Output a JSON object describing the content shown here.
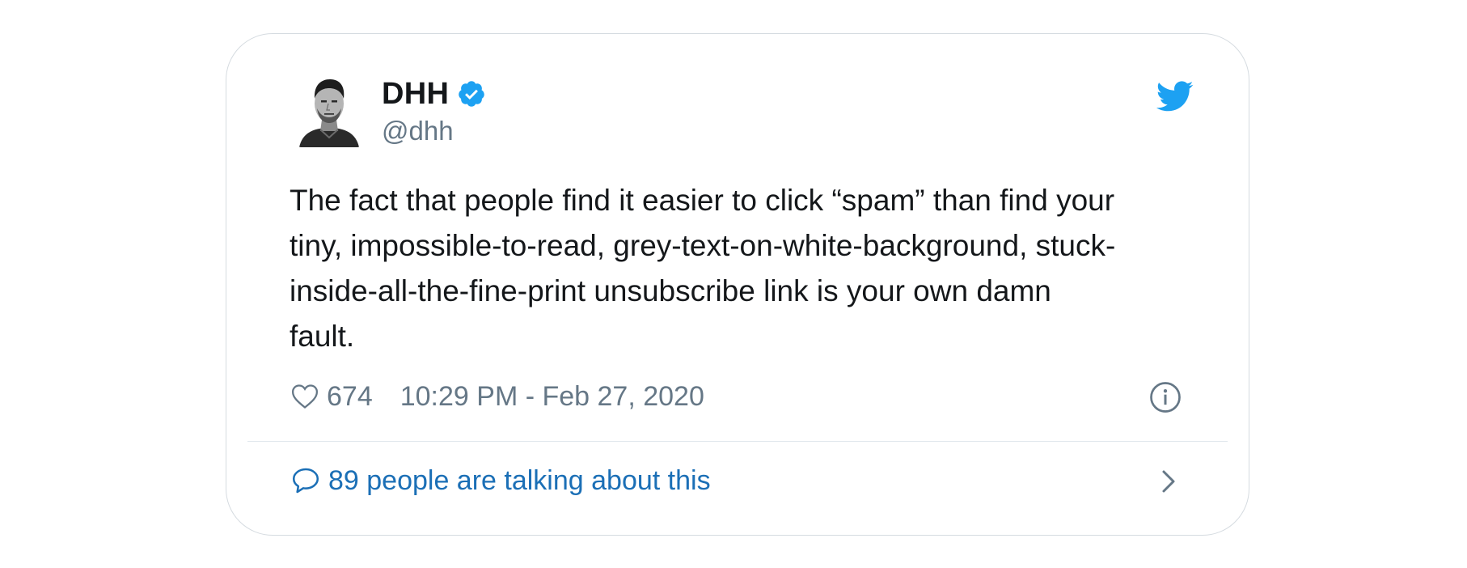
{
  "tweet": {
    "author": {
      "display_name": "DHH",
      "handle": "@dhh",
      "verified": true,
      "avatar_icon": "person-photo-icon"
    },
    "text": "The fact that people find it easier to click “spam” than find your\ntiny, impossible-to-read, grey-text-on-white-background, stuck-\ninside-all-the-fine-print unsubscribe link is your own damn\nfault.",
    "likes": "674",
    "timestamp": "10:29 PM - Feb 27, 2020",
    "conversation_label": "89 people are talking about this"
  },
  "icons": {
    "brand": "twitter-bird-icon",
    "verified": "verified-badge-icon",
    "like": "heart-icon",
    "info": "info-icon",
    "conversation": "speech-bubble-icon",
    "chevron": "chevron-right-icon"
  },
  "colors": {
    "brand_blue": "#1da1f2",
    "link_blue": "#1b6fb6",
    "text_primary": "#14171a",
    "text_secondary": "#657786",
    "border": "#d5dbe0"
  }
}
